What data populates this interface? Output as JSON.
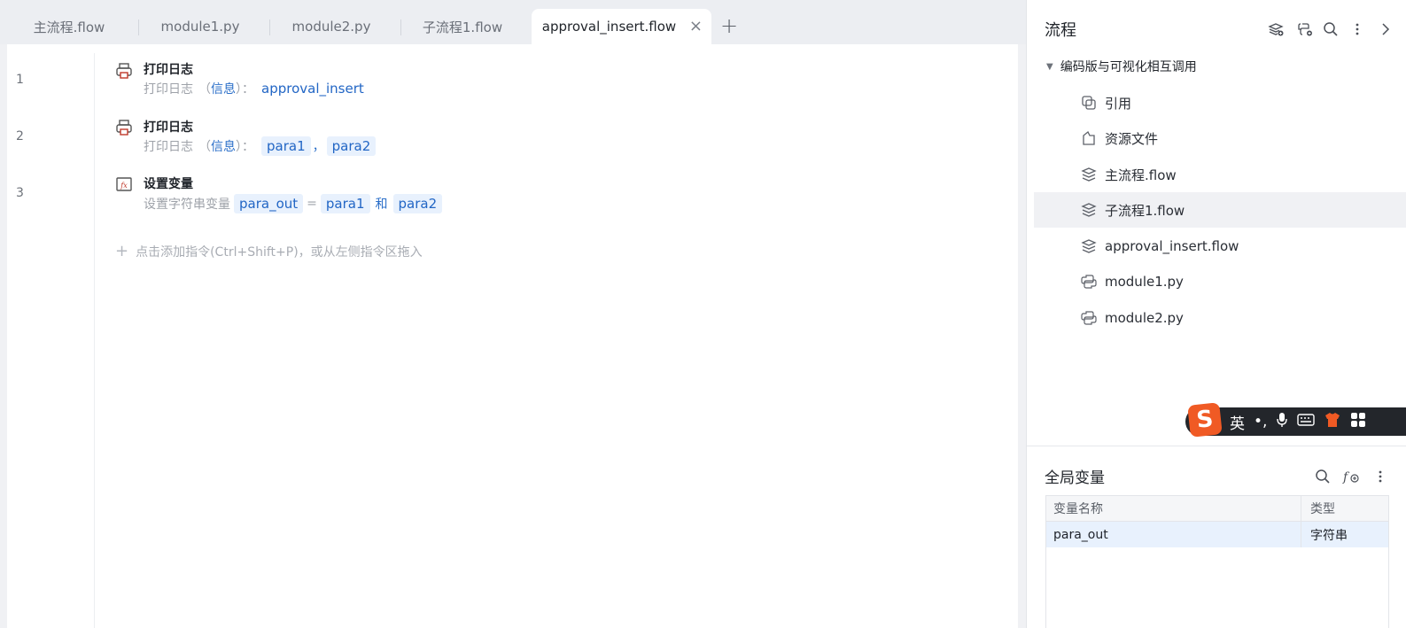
{
  "tabs": [
    {
      "label": "主流程.flow"
    },
    {
      "label": "module1.py"
    },
    {
      "label": "module2.py"
    },
    {
      "label": "子流程1.flow"
    },
    {
      "label": "approval_insert.flow",
      "active": true
    }
  ],
  "tab_add": "+",
  "tab_close": "×",
  "editor": {
    "lines": [
      {
        "number": "1",
        "title": "打印日志",
        "desc_prefix": "打印日志",
        "param_open": "（",
        "param_name": "信息",
        "param_close": "）：",
        "value": "approval_insert"
      },
      {
        "number": "2",
        "title": "打印日志",
        "desc_prefix": "打印日志",
        "param_open": "（",
        "param_name": "信息",
        "param_close": "）：",
        "value1": "para1",
        "value_sep": "，",
        "value2": "para2"
      },
      {
        "number": "3",
        "title": "设置变量",
        "desc_prefix": "设置字符串变量",
        "var": "para_out",
        "eq": "=",
        "value1": "para1",
        "joiner": "和",
        "value2": "para2"
      }
    ],
    "add_hint": "点击添加指令(Ctrl+Shift+P)，或从左侧指令区拖入",
    "add_plus": "+"
  },
  "flow_panel": {
    "title": "流程",
    "root": "编码版与可视化相互调用",
    "items": [
      {
        "label": "引用",
        "icon": "reference-icon"
      },
      {
        "label": "资源文件",
        "icon": "resource-icon"
      },
      {
        "label": "主流程.flow",
        "icon": "layers-icon"
      },
      {
        "label": "子流程1.flow",
        "icon": "layers-icon",
        "selected": true
      },
      {
        "label": "approval_insert.flow",
        "icon": "layers-icon"
      },
      {
        "label": "module1.py",
        "icon": "python-icon"
      },
      {
        "label": "module2.py",
        "icon": "python-icon"
      }
    ]
  },
  "ime": {
    "logo": "S",
    "mode": "英",
    "punct": "•,"
  },
  "global_vars": {
    "title": "全局变量",
    "columns": [
      "变量名称",
      "类型"
    ],
    "rows": [
      {
        "name": "para_out",
        "type": "字符串"
      }
    ]
  }
}
